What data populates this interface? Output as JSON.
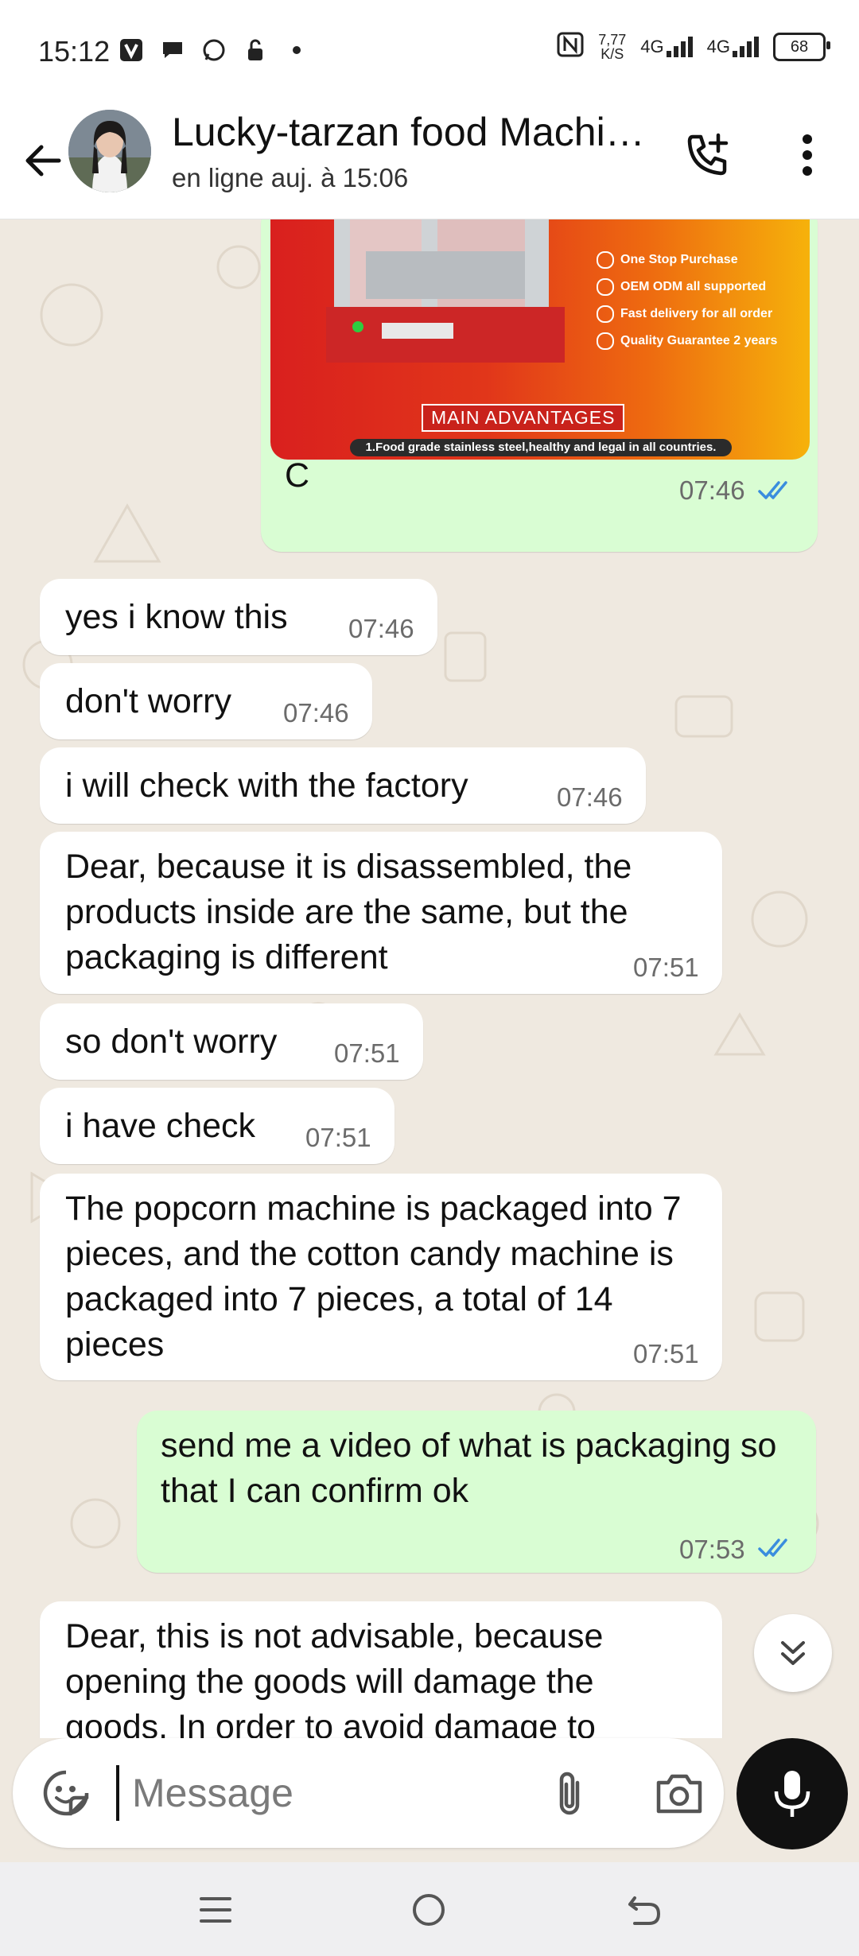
{
  "status_bar": {
    "time": "15:12",
    "speed_value": "7,77",
    "speed_unit": "K/S",
    "net1": "4G",
    "net2": "4G",
    "battery": "68"
  },
  "header": {
    "contact_name": "Lucky-tarzan food Machi…",
    "status": "en ligne auj. à 15:06"
  },
  "image_message": {
    "features": [
      "One Stop Purchase",
      "OEM ODM all supported",
      "Fast delivery for all order",
      "Quality Guarantee 2 years"
    ],
    "advantages_label": "MAIN ADVANTAGES",
    "footer_text": "1.Food grade stainless steel,healthy and legal in all countries.",
    "caption": "C",
    "time": "07:46"
  },
  "messages": [
    {
      "text": "yes i know this",
      "time": "07:46"
    },
    {
      "text": "don't worry",
      "time": "07:46"
    },
    {
      "text": "i will check with the factory",
      "time": "07:46"
    },
    {
      "text": "Dear, because it is disassembled, the products inside are the same, but the packaging is different",
      "time": "07:51"
    },
    {
      "text": "so don't worry",
      "time": "07:51"
    },
    {
      "text": "i have check",
      "time": "07:51"
    },
    {
      "text": "The popcorn machine is packaged into 7 pieces, and the cotton candy machine is packaged into 7 pieces, a total of 14 pieces",
      "time": "07:51"
    },
    {
      "text": "send me a video of what is packaging so that I can confirm ok",
      "time": "07:53"
    },
    {
      "text": "Dear, this is not advisable, because opening the goods will damage the goods. In order to avoid damage to",
      "time": ""
    }
  ],
  "input": {
    "placeholder": "Message"
  },
  "colors": {
    "incoming": "#ffffff",
    "outgoing": "#d9fdd3",
    "read_ticks": "#3a8dde",
    "wallpaper": "#efe9e0"
  }
}
